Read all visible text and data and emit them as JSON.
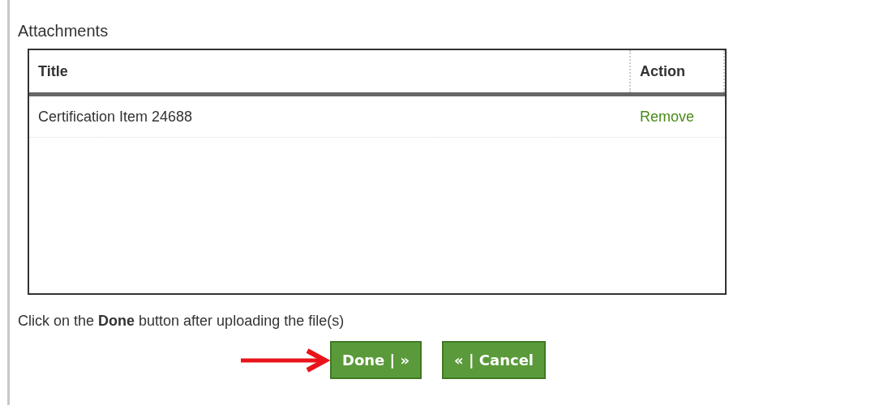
{
  "section_title": "Attachments",
  "table": {
    "columns": [
      "Title",
      "Action"
    ],
    "rows": [
      {
        "title": "Certification Item 24688",
        "action": "Remove"
      }
    ]
  },
  "instruction": "Click on the **Done** button after uploading the file(s)",
  "controls": [
    {
      "kind": "arrow"
    },
    {
      "kind": "button",
      "label": "Done | »"
    },
    {
      "kind": "button",
      "label": "« | Cancel"
    }
  ]
}
